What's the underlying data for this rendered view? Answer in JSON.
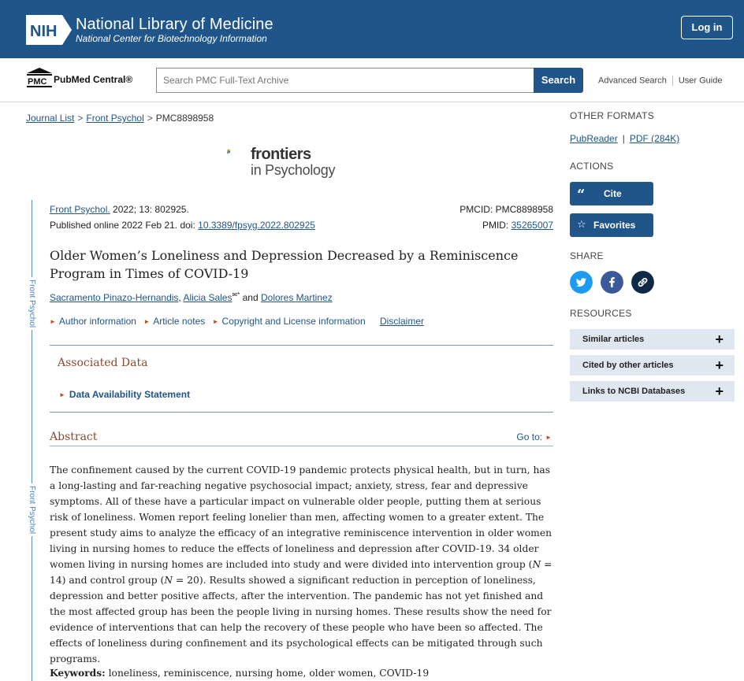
{
  "nih": {
    "logo_text": "NIH",
    "title": "National Library of Medicine",
    "subtitle": "National Center for Biotechnology Information",
    "login_label": "Log in"
  },
  "pmc": {
    "logo_text": "PMC",
    "brand_label": "PubMed Central®",
    "search_placeholder": "Search PMC Full-Text Archive",
    "search_button": "Search",
    "advanced_search": "Advanced Search",
    "user_guide": "User Guide"
  },
  "breadcrumb": {
    "items": [
      "Journal List",
      "Front Psychol",
      "PMC8898958"
    ],
    "separator": ">"
  },
  "journal": {
    "name_line1": "frontiers",
    "name_line2": "in Psychology"
  },
  "rail": {
    "label": "Front Psychol"
  },
  "citation": {
    "journal_link": "Front Psychol.",
    "volume_info": " 2022; 13: 802925.",
    "published_prefix": "Published online 2022 Feb 21. doi: ",
    "doi": "10.3389/fpsyg.2022.802925",
    "pmcid_label": "PMCID: PMC8898958",
    "pmid_label": "PMID: ",
    "pmid": "35265007"
  },
  "article": {
    "title": "Older Women’s Loneliness and Depression Decreased by a Reminiscence Program in Times of COVID-19",
    "authors": [
      {
        "name": "Sacramento Pinazo-Hernandis",
        "sep": ", "
      },
      {
        "name": "Alicia Sales",
        "sup": "✉*",
        "sep": " and "
      },
      {
        "name": "Dolores Martinez",
        "sep": ""
      }
    ],
    "info_links": [
      "Author information",
      "Article notes",
      "Copyright and License information"
    ],
    "disclaimer": "Disclaimer"
  },
  "associated": {
    "title": "Associated Data",
    "item": "Data Availability Statement"
  },
  "abstract": {
    "heading": "Abstract",
    "goto": "Go to:",
    "text_part1": "The confinement caused by the current COVID-19 pandemic protects physical health, but in turn, has a long-lasting and far-reaching negative psychosocial impact; anxiety, stress, fear and depressive symptoms. All of these have a particular impact on vulnerable older people, putting them at serious risk of loneliness. Women report feeling lonelier than men, affecting women to a greater extent. The present study aims to analyze the efficacy of an integrative reminiscence intervention in older women living in nursing homes to reduce the effects of loneliness and depression after COVID-19. 34 older women living in nursing homes are included into study and were divided into intervention group (",
    "n_symbol": "N",
    "text_part2": " = 14) and control group (",
    "text_part3": " = 20). Results showed a significant reduction in perception of loneliness, depression and better positive affects, after the intervention. The pandemic has not yet finished and the most affected group has been the people living in nursing homes. These results show the need for evidence of interventions that can help the recovery of these people who have been so affected. The effects of loneliness during confinement and its psychological effects can be mitigated through such programs.",
    "keywords_label": "Keywords:",
    "keywords": " loneliness, reminiscence, nursing home, older women, COVID-19"
  },
  "sidebar": {
    "other_formats_heading": "OTHER FORMATS",
    "pubreader": "PubReader",
    "pdf": "PDF (284K)",
    "actions_heading": "ACTIONS",
    "cite_label": "Cite",
    "favorites_label": "Favorites",
    "share_heading": "SHARE",
    "resources_heading": "RESOURCES",
    "resources": [
      "Similar articles",
      "Cited by other articles",
      "Links to NCBI Databases"
    ]
  },
  "colors": {
    "brand_blue": "#20558a",
    "accent_orange": "#c44b1b",
    "heading_brown": "#8a4b2d",
    "twitter": "#1d9bf0",
    "facebook": "#3b5998",
    "link_dark": "#0e2a47"
  }
}
